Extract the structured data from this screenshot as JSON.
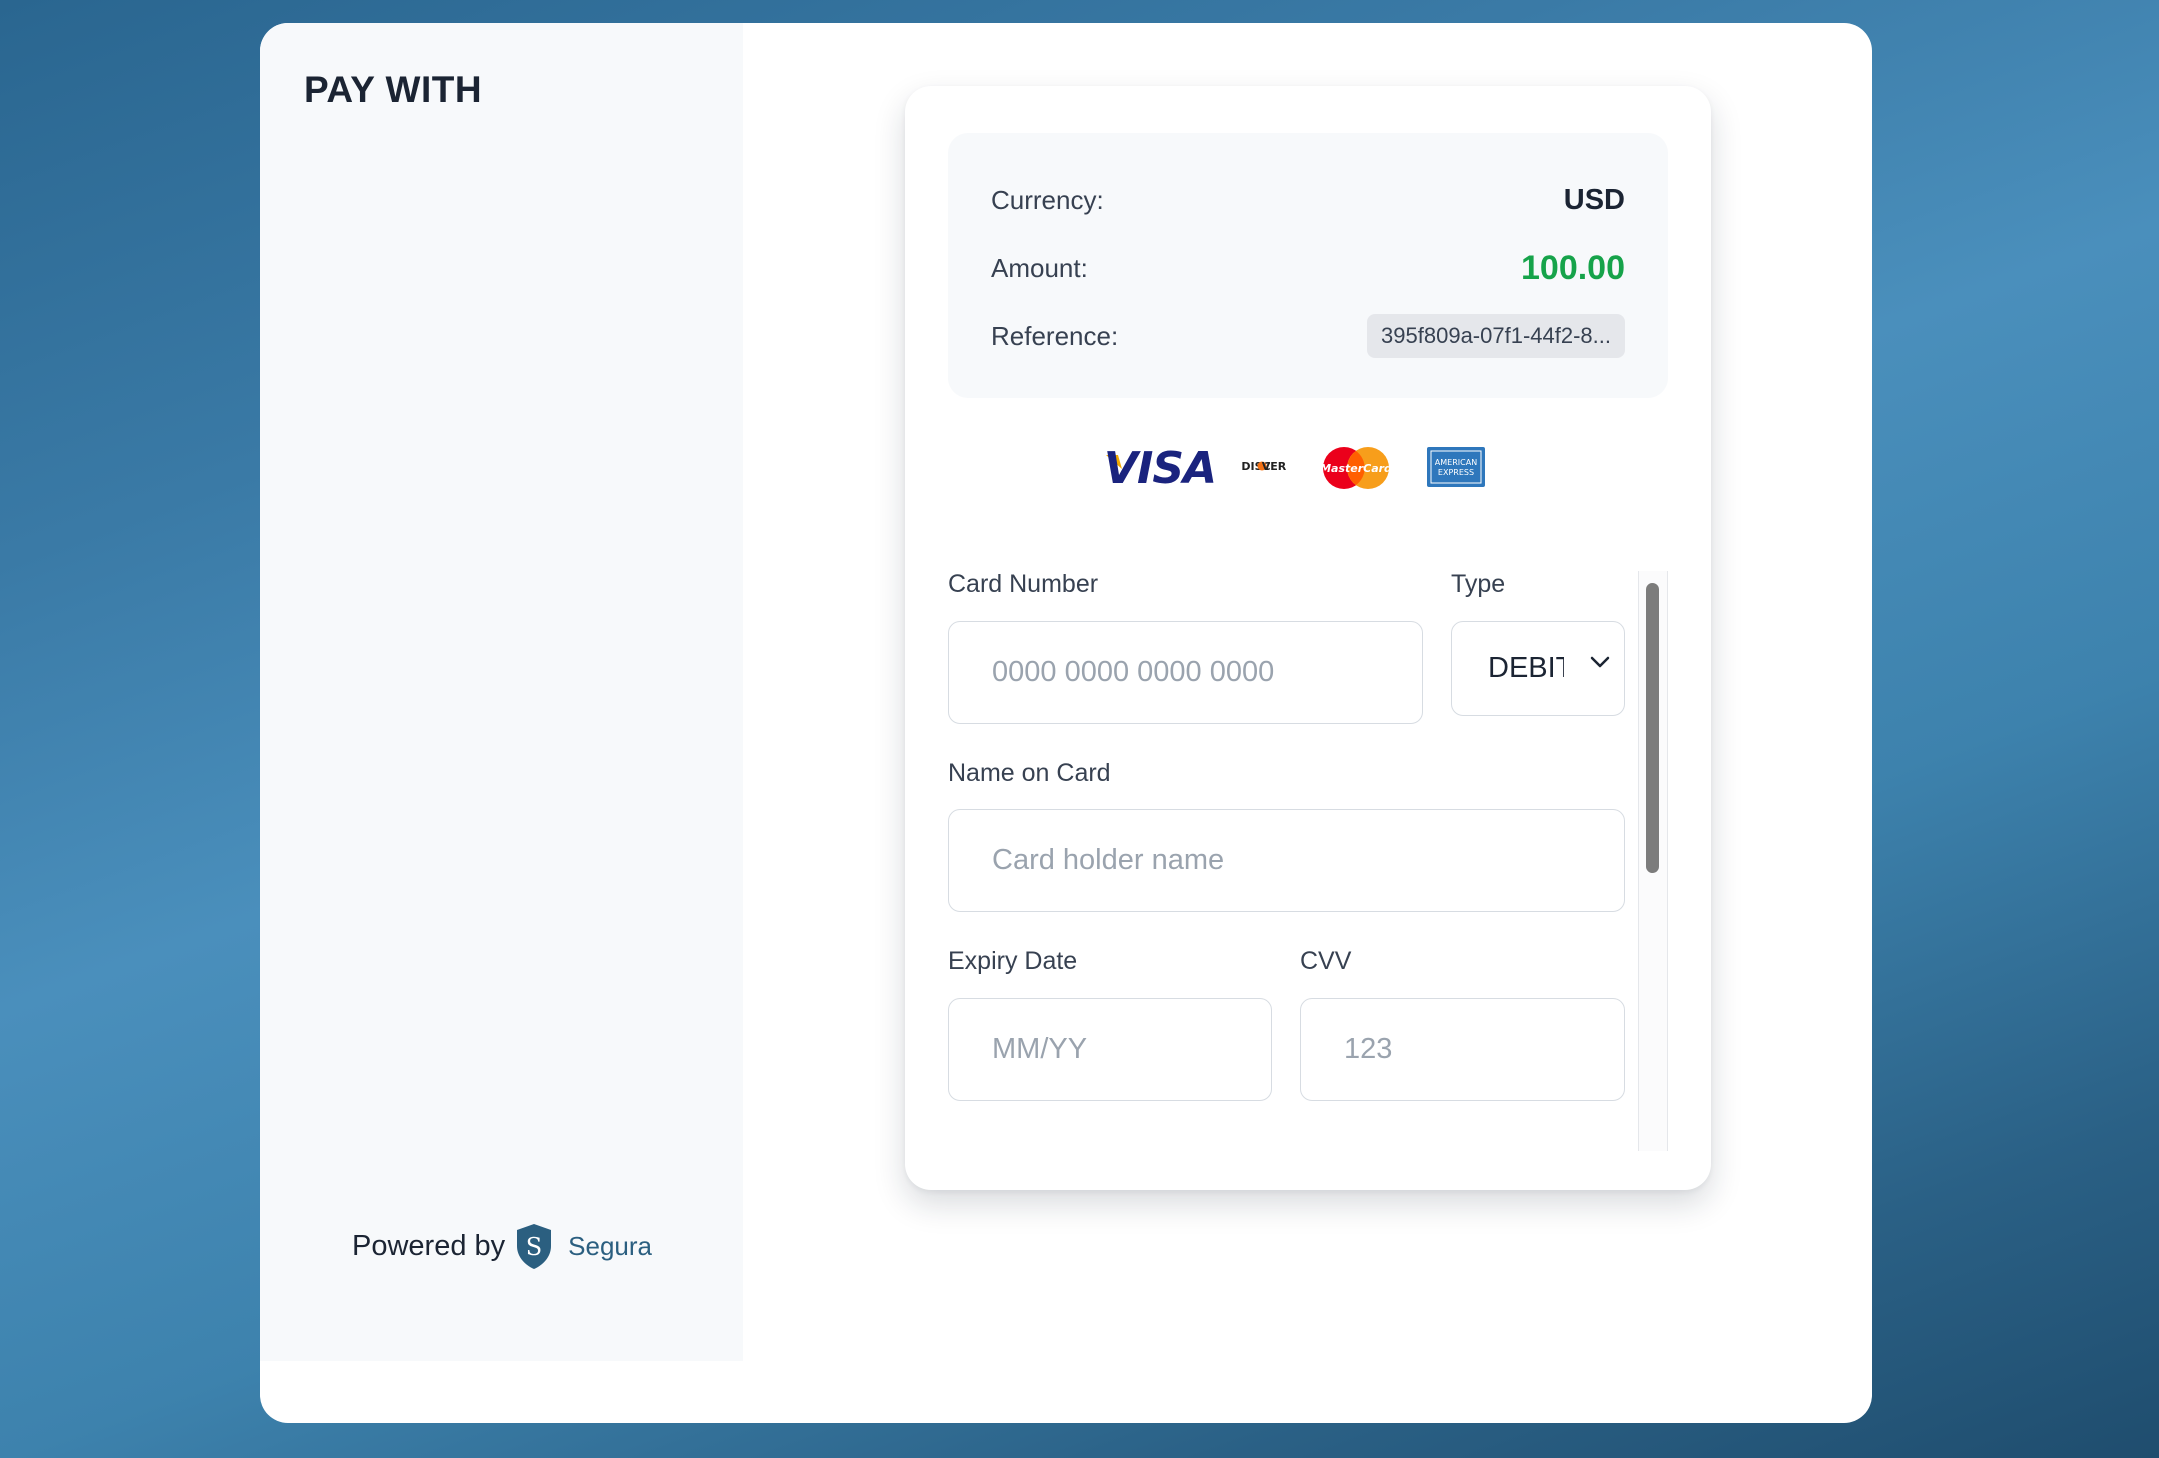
{
  "sidebar": {
    "title": "PAY WITH",
    "powered_by": "Powered by",
    "brand": "Segura"
  },
  "summary": {
    "currency_label": "Currency:",
    "currency_value": "USD",
    "amount_label": "Amount:",
    "amount_value": "100.00",
    "reference_label": "Reference:",
    "reference_value": "395f809a-07f1-44f2-8..."
  },
  "card_logos": {
    "visa": "VISA",
    "discover": "DISCOVER",
    "mastercard": "MasterCard",
    "amex": "AMERICAN EXPRESS"
  },
  "form": {
    "card_number_label": "Card Number",
    "card_number_placeholder": "0000 0000 0000 0000",
    "type_label": "Type",
    "type_value": "DEBIT",
    "name_label": "Name on Card",
    "name_placeholder": "Card holder name",
    "expiry_label": "Expiry Date",
    "expiry_placeholder": "MM/YY",
    "cvv_label": "CVV",
    "cvv_placeholder": "123"
  },
  "colors": {
    "amount": "#16a34a",
    "brand": "#2b5f80",
    "text": "#1b2433"
  }
}
